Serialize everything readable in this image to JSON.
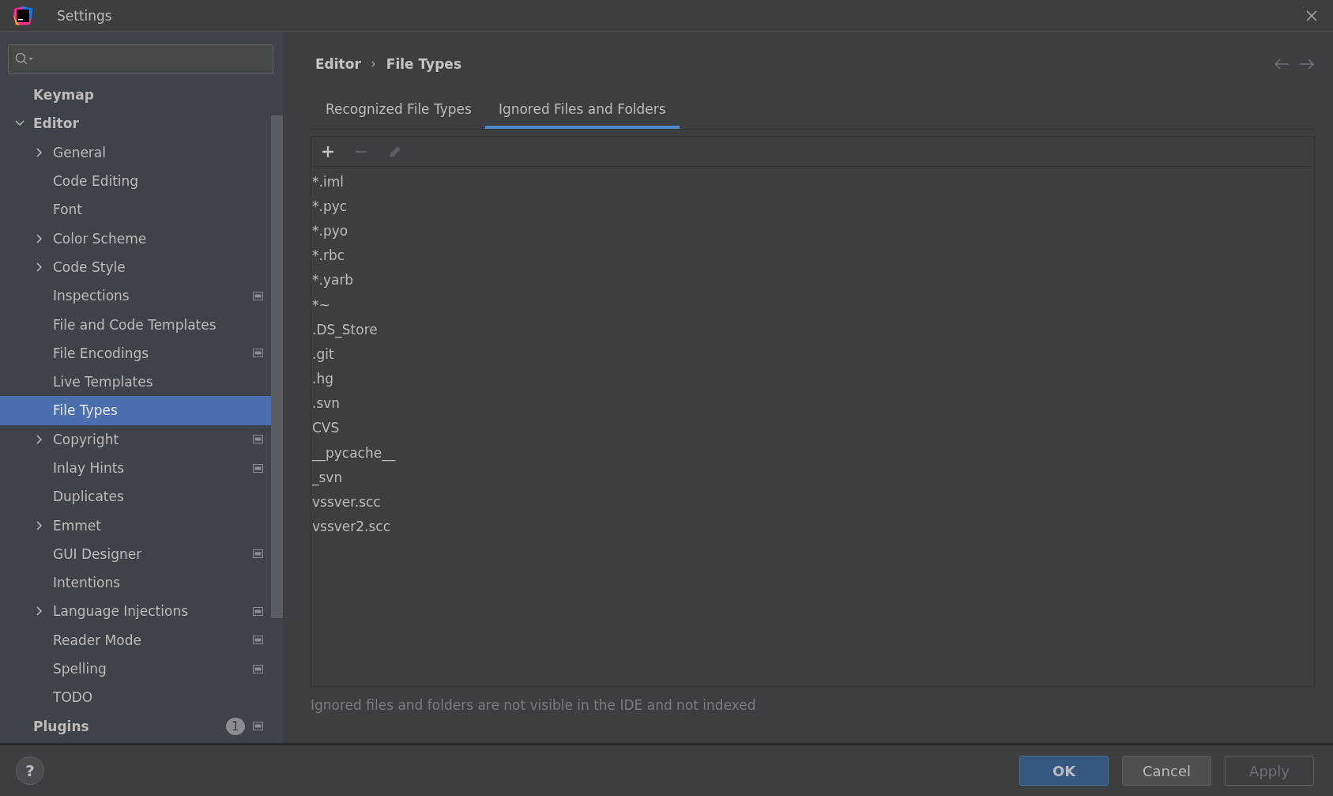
{
  "window": {
    "title": "Settings"
  },
  "sidebar": {
    "items": [
      {
        "label": "Keymap",
        "selected": false
      },
      {
        "label": "Editor",
        "expanded": true,
        "selected": false,
        "children": [
          {
            "label": "General",
            "expandable": true,
            "expanded": false,
            "selected": false,
            "project_level": false
          },
          {
            "label": "Code Editing",
            "expandable": false,
            "expanded": false,
            "selected": false,
            "project_level": false
          },
          {
            "label": "Font",
            "expandable": false,
            "expanded": false,
            "selected": false,
            "project_level": false
          },
          {
            "label": "Color Scheme",
            "expandable": true,
            "expanded": false,
            "selected": false,
            "project_level": false
          },
          {
            "label": "Code Style",
            "expandable": true,
            "expanded": false,
            "selected": false,
            "project_level": false
          },
          {
            "label": "Inspections",
            "expandable": false,
            "expanded": false,
            "selected": false,
            "project_level": true
          },
          {
            "label": "File and Code Templates",
            "expandable": false,
            "expanded": false,
            "selected": false,
            "project_level": false
          },
          {
            "label": "File Encodings",
            "expandable": false,
            "expanded": false,
            "selected": false,
            "project_level": true
          },
          {
            "label": "Live Templates",
            "expandable": false,
            "expanded": false,
            "selected": false,
            "project_level": false
          },
          {
            "label": "File Types",
            "expandable": false,
            "expanded": false,
            "selected": true,
            "project_level": false
          },
          {
            "label": "Copyright",
            "expandable": true,
            "expanded": false,
            "selected": false,
            "project_level": true
          },
          {
            "label": "Inlay Hints",
            "expandable": false,
            "expanded": false,
            "selected": false,
            "project_level": true
          },
          {
            "label": "Duplicates",
            "expandable": false,
            "expanded": false,
            "selected": false,
            "project_level": false
          },
          {
            "label": "Emmet",
            "expandable": true,
            "expanded": false,
            "selected": false,
            "project_level": false
          },
          {
            "label": "GUI Designer",
            "expandable": false,
            "expanded": false,
            "selected": false,
            "project_level": true
          },
          {
            "label": "Intentions",
            "expandable": false,
            "expanded": false,
            "selected": false,
            "project_level": false
          },
          {
            "label": "Language Injections",
            "expandable": true,
            "expanded": false,
            "selected": false,
            "project_level": true
          },
          {
            "label": "Reader Mode",
            "expandable": false,
            "expanded": false,
            "selected": false,
            "project_level": true
          },
          {
            "label": "Spelling",
            "expandable": false,
            "expanded": false,
            "selected": false,
            "project_level": true
          },
          {
            "label": "TODO",
            "expandable": false,
            "expanded": false,
            "selected": false,
            "project_level": false
          }
        ]
      },
      {
        "label": "Plugins",
        "selected": false,
        "badge": "1",
        "project_level": true
      }
    ]
  },
  "breadcrumb": [
    "Editor",
    "File Types"
  ],
  "tabs": [
    {
      "label": "Recognized File Types",
      "selected": false
    },
    {
      "label": "Ignored Files and Folders",
      "selected": true
    }
  ],
  "toolbar": [
    {
      "kind": "add",
      "disabled": false
    },
    {
      "kind": "remove",
      "disabled": true
    },
    {
      "kind": "edit",
      "disabled": true
    }
  ],
  "ignored": [
    "*.iml",
    "*.pyc",
    "*.pyo",
    "*.rbc",
    "*.yarb",
    "*~",
    ".DS_Store",
    ".git",
    ".hg",
    ".svn",
    "CVS",
    "__pycache__",
    "_svn",
    "vssver.scc",
    "vssver2.scc"
  ],
  "hint": "Ignored files and folders are not visible in the IDE and not indexed",
  "buttons": [
    {
      "label": "OK",
      "kind": "default",
      "disabled": false
    },
    {
      "label": "Cancel",
      "kind": "normal",
      "disabled": false
    },
    {
      "label": "Apply",
      "kind": "normal",
      "disabled": true
    }
  ],
  "help": "?"
}
